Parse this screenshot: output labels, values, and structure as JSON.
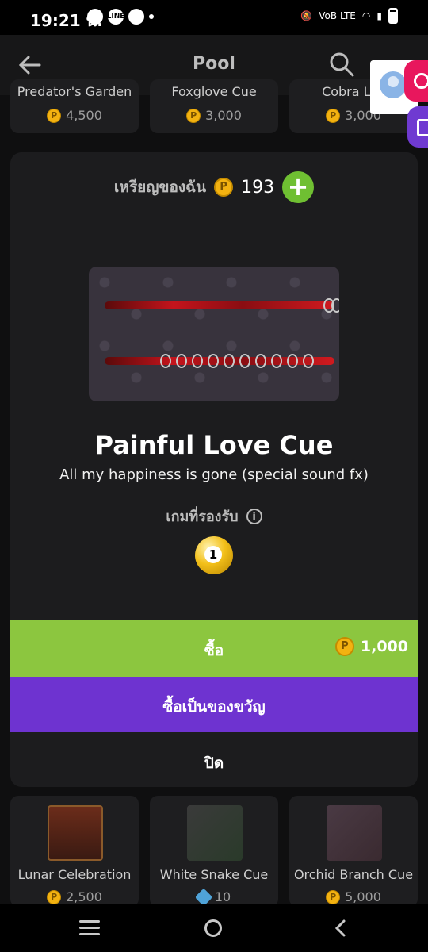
{
  "status_bar": {
    "time": "19:21 น.",
    "network": "VoB LTE"
  },
  "app_bar": {
    "title": "Pool"
  },
  "background_items_top": [
    {
      "name": "Predator's Garden",
      "price": "4,500"
    },
    {
      "name": "Foxglove Cue",
      "price": "3,000"
    },
    {
      "name": "Cobra Lily",
      "price": "3,000"
    }
  ],
  "background_items_bottom": [
    {
      "name": "Lunar Celebration",
      "price": "2,500",
      "currency": "coin"
    },
    {
      "name": "White Snake Cue",
      "price": "10",
      "currency": "gem"
    },
    {
      "name": "Orchid Branch Cue",
      "price": "5,000",
      "currency": "coin"
    }
  ],
  "modal": {
    "coins_label": "เหรียญของฉัน",
    "coins_value": "193",
    "coin_symbol": "P",
    "add_symbol": "+",
    "item_title": "Painful Love Cue",
    "item_description": "All my happiness is gone (special sound fx)",
    "supported_games_label": "เกมที่รองรับ",
    "info_symbol": "i",
    "buy_label": "ซื้อ",
    "buy_price": "1,000",
    "gift_label": "ซื้อเป็นของขวัญ",
    "close_label": "ปิด"
  },
  "colors": {
    "buy_button": "#8cc63f",
    "gift_button": "#6e33d0",
    "add_button": "#6fbf32",
    "coin": "#f3b211"
  }
}
